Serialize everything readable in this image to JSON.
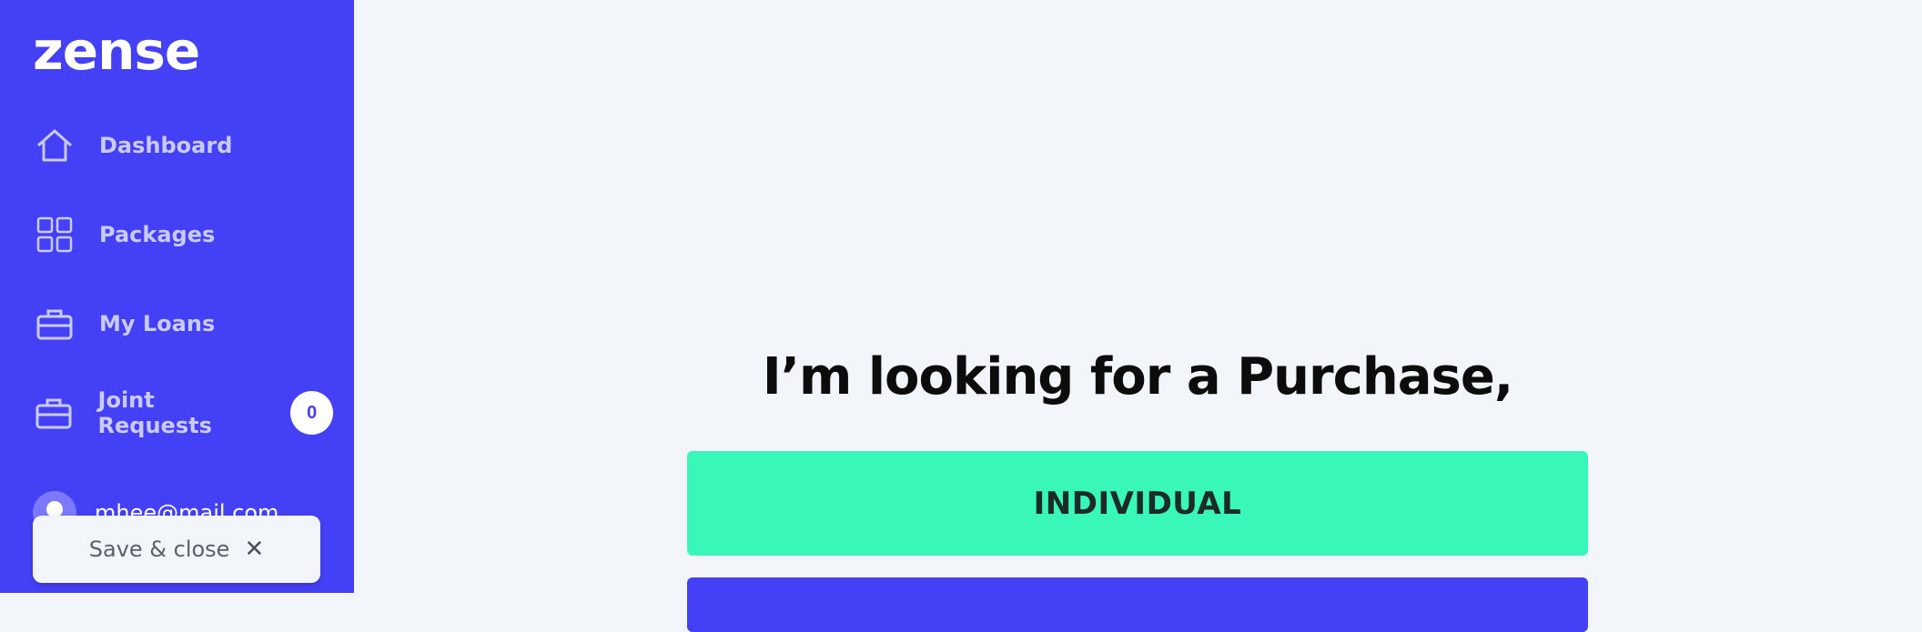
{
  "brand": {
    "logo_text": "zense"
  },
  "sidebar": {
    "items": [
      {
        "label": "Dashboard",
        "icon": "home-icon"
      },
      {
        "label": "Packages",
        "icon": "grid-icon"
      },
      {
        "label": "My Loans",
        "icon": "briefcase-icon"
      },
      {
        "label": "Joint Requests",
        "icon": "briefcase-icon",
        "badge": "0"
      }
    ],
    "user": {
      "email": "mhee@mail.com",
      "icon": "user-icon"
    },
    "save_close": {
      "label": "Save & close",
      "icon": "close-icon"
    }
  },
  "main": {
    "heading": "I’m looking for a Purchase,",
    "options": [
      {
        "label": "INDIVIDUAL"
      },
      {
        "label": ""
      }
    ]
  },
  "colors": {
    "sidebar_bg": "#4440f5",
    "page_bg": "#f2f5fa",
    "individual_bg": "#38f7b8",
    "joint_bg": "#4440f5",
    "nav_text": "#c9cbff"
  }
}
